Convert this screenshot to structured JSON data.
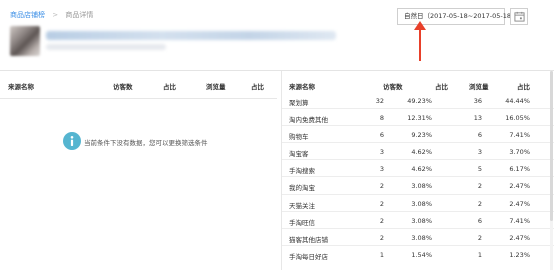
{
  "breadcrumb": {
    "parent": "商品店铺榜",
    "separator": ">",
    "current": "商品详情"
  },
  "date_range": {
    "label": "自然日（2017-05-18~2017-05-18）"
  },
  "left_table": {
    "headers": [
      "来源名称",
      "访客数",
      "占比",
      "浏览量",
      "占比"
    ],
    "empty_message": "当前条件下没有数据，您可以更换筛选条件"
  },
  "right_table": {
    "headers": [
      "来源名称",
      "访客数",
      "占比",
      "浏览量",
      "占比"
    ],
    "rows": [
      {
        "name": "聚划算",
        "visitors": "32",
        "visitor_ratio": "49.23%",
        "views": "36",
        "view_ratio": "44.44%"
      },
      {
        "name": "淘内免费其他",
        "visitors": "8",
        "visitor_ratio": "12.31%",
        "views": "13",
        "view_ratio": "16.05%"
      },
      {
        "name": "购物车",
        "visitors": "6",
        "visitor_ratio": "9.23%",
        "views": "6",
        "view_ratio": "7.41%"
      },
      {
        "name": "淘宝客",
        "visitors": "3",
        "visitor_ratio": "4.62%",
        "views": "3",
        "view_ratio": "3.70%"
      },
      {
        "name": "手淘搜索",
        "visitors": "3",
        "visitor_ratio": "4.62%",
        "views": "5",
        "view_ratio": "6.17%"
      },
      {
        "name": "我的淘宝",
        "visitors": "2",
        "visitor_ratio": "3.08%",
        "views": "2",
        "view_ratio": "2.47%"
      },
      {
        "name": "天猫关注",
        "visitors": "2",
        "visitor_ratio": "3.08%",
        "views": "2",
        "view_ratio": "2.47%"
      },
      {
        "name": "手淘旺信",
        "visitors": "2",
        "visitor_ratio": "3.08%",
        "views": "6",
        "view_ratio": "7.41%"
      },
      {
        "name": "猫客其他店铺",
        "visitors": "2",
        "visitor_ratio": "3.08%",
        "views": "2",
        "view_ratio": "2.47%"
      },
      {
        "name": "手淘每日好店",
        "visitors": "1",
        "visitor_ratio": "1.54%",
        "views": "1",
        "view_ratio": "1.23%"
      }
    ]
  },
  "colors": {
    "accent": "#3a8ee6",
    "info": "#55b5d0",
    "arrow": "#e8402a"
  }
}
